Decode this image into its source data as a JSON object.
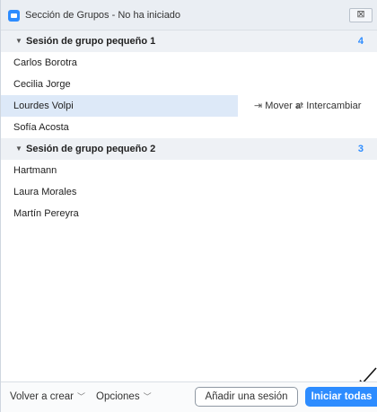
{
  "window": {
    "title": "Sección de Grupos - No ha iniciado",
    "close_glyph": "⊠"
  },
  "groups": [
    {
      "name": "Sesión de grupo pequeño 1",
      "count": "4",
      "participants": [
        "Carlos Borotra",
        "Cecilia Jorge",
        "Lourdes Volpi",
        "Sofía Acosta"
      ]
    },
    {
      "name": "Sesión de grupo pequeño 2",
      "count": "3",
      "participants": [
        "Hartmann",
        "Laura Morales",
        "Martín Pereyra"
      ]
    }
  ],
  "row_actions": {
    "move_label": "Mover a",
    "swap_label": "Intercambiar"
  },
  "footer": {
    "recreate_label": "Volver a crear",
    "options_label": "Opciones",
    "add_session_label": "Añadir una sesión",
    "start_all_label": "Iniciar todas"
  },
  "colors": {
    "accent": "#2d8cff",
    "selected_row": "#dde9f8",
    "group_header": "#eef1f5"
  }
}
